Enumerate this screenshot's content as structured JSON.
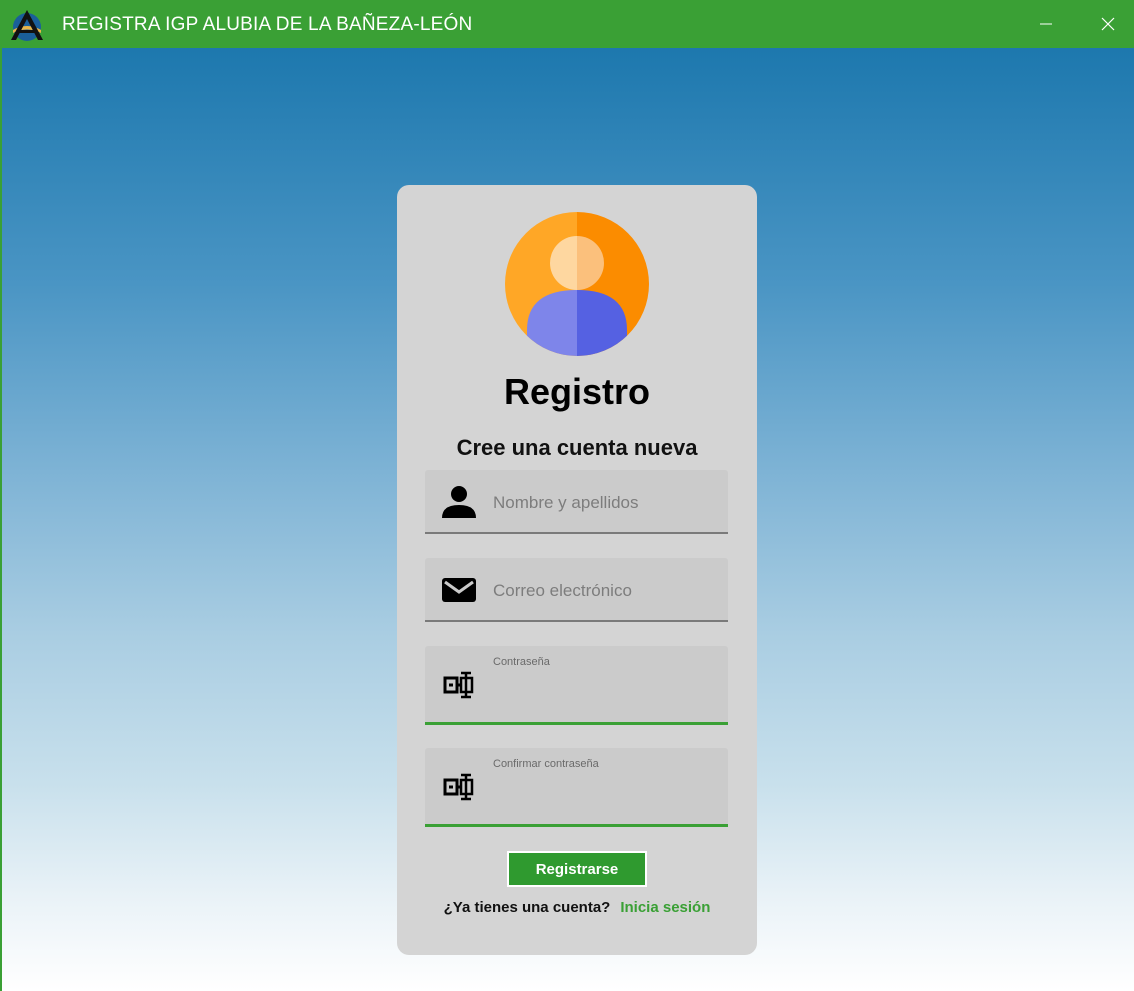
{
  "window": {
    "title": "REGISTRA IGP ALUBIA DE LA BAÑEZA-LEÓN",
    "accent_color": "#3aa035",
    "controls": {
      "minimize_icon": "minimize-icon",
      "close_icon": "close-icon"
    }
  },
  "form": {
    "avatar_icon": "user-avatar-icon",
    "title": "Registro",
    "subtitle": "Cree una cuenta nueva",
    "fields": {
      "name": {
        "icon": "user-icon",
        "placeholder": "Nombre y apellidos",
        "value": ""
      },
      "email": {
        "icon": "envelope-icon",
        "placeholder": "Correo electrónico",
        "value": ""
      },
      "password": {
        "icon": "password-icon",
        "label": "Contraseña",
        "value": ""
      },
      "confirm_password": {
        "icon": "password-icon",
        "label": "Confirmar contraseña",
        "value": ""
      }
    },
    "submit_label": "Registrarse",
    "login_question": "¿Ya tienes una cuenta?",
    "login_link": "Inicia sesión"
  }
}
